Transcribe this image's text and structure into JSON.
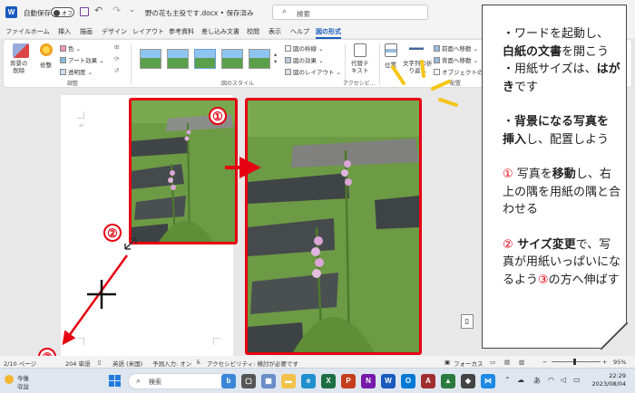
{
  "titlebar": {
    "app_icon": "W",
    "autosave_label": "自動保存",
    "autosave_state": "オフ",
    "document_title": "野の花も主役です.docx • 保存済み",
    "more": "⌄",
    "search_placeholder": "検索"
  },
  "tabs": [
    "ファイル",
    "ホーム",
    "挿入",
    "描画",
    "デザイン",
    "レイアウト",
    "参考資料",
    "差し込み文書",
    "校閲",
    "表示",
    "ヘルプ",
    "図の形式"
  ],
  "active_tab": "図の形式",
  "ribbon": {
    "remove_bg": "背景の\n削除",
    "corrections": "修整",
    "color": "色",
    "artistic_effects": "アート効果",
    "transparency": "透明度",
    "group_adjust": "調整",
    "group_styles": "図のスタイル",
    "border": "図の枠線",
    "effects": "図の効果",
    "layout": "図のレイアウト",
    "alt_text": "代替テ\nキスト",
    "group_accessibility": "アクセシビ...",
    "position": "位置",
    "wrap_text": "文字列の折\nり返し",
    "bring_forward": "前面へ移動",
    "send_backward": "背面へ移動",
    "selection_pane": "オブジェクトの選択",
    "group_arrange": "配置"
  },
  "document": {
    "badge1": "①",
    "badge2": "②",
    "badge3": "③"
  },
  "callout": {
    "p1a": "・ワードを起動し、",
    "p1b": "白紙の文書",
    "p1c": "を開こう",
    "p2a": "・用紙サイズは、",
    "p2b": "はがき",
    "p2c": "です",
    "p3a": "・",
    "p3b": "背景になる写真を挿入",
    "p3c": "し、配置しよう",
    "p4a": "①",
    "p4b": " 写真を",
    "p4c": "移動",
    "p4d": "し、右上の隅を用紙の隅と合わせる",
    "p5a": "②",
    "p5b": " サイズ変更",
    "p5c": "で、写真が用紙いっぱいになるよう",
    "p5d": "③",
    "p5e": "の方へ伸ばす"
  },
  "statusbar": {
    "page": "2/10 ページ",
    "words": "204 単語",
    "language": "英語 (米国)",
    "predictive": "予測入力: オン",
    "accessibility": "アクセシビリティ: 検討が必要です",
    "focus": "フォーカス",
    "zoom": "95%"
  },
  "taskbar": {
    "weather_line1": "今後",
    "weather_line2": "収益",
    "search_placeholder": "検索",
    "time": "22:29",
    "date": "2023/08/04",
    "ime": "あ"
  },
  "colors": {
    "accent_red": "#e60012",
    "word_blue": "#185abd"
  }
}
